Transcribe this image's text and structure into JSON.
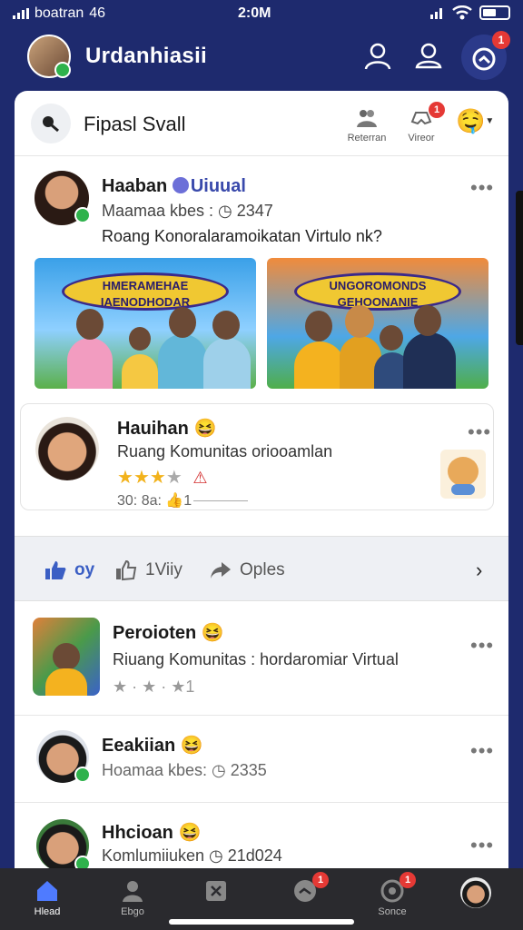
{
  "status_bar": {
    "carrier": "boatran",
    "network": "46",
    "time": "2:0M"
  },
  "header": {
    "title": "Urdanhiasii",
    "notification_count": "1"
  },
  "feed_header": {
    "title": "Fipasl Svall",
    "actions": [
      {
        "label": "Reterran",
        "badge": ""
      },
      {
        "label": "Vireor",
        "badge": "1"
      }
    ]
  },
  "post": {
    "author": "Haaban",
    "tag": "Uiuual",
    "meta": "Maamaa kbes : ◷ 2347",
    "text": "Roang Konoralaramoikatan Virtulo nk?",
    "photos": [
      {
        "banner": "HMERAMEHAE IAENODHODAR"
      },
      {
        "banner": "UNGOROMONDS GEHOONANIE"
      }
    ]
  },
  "review": {
    "author": "Hauihan",
    "emoji": "😆",
    "text": "Ruang Komunitas oriooamlan",
    "rating": 3,
    "max_rating": 4,
    "footer": "30: 8a: 👍1"
  },
  "actions": {
    "like": "oy",
    "comment": "1Viiy",
    "share": "Oples"
  },
  "list": [
    {
      "name": "Peroioten",
      "emoji": "😆",
      "sub": "Riuang Komunitas : hordaromiar Virtual",
      "footer": "★ · ★ · ★1"
    },
    {
      "name": "Eeakiian",
      "emoji": "😆",
      "sub": "Hoamaa kbes: ◷ 2335"
    },
    {
      "name": "Hhcioan",
      "emoji": "😆",
      "sub": "Komlumiiuken ◷ 21d024"
    }
  ],
  "bottom_nav": [
    {
      "label": "Hlead",
      "icon": "home-icon",
      "badge": ""
    },
    {
      "label": "Ebgo",
      "icon": "profile-icon",
      "badge": ""
    },
    {
      "label": "",
      "icon": "app-icon",
      "badge": ""
    },
    {
      "label": "",
      "icon": "chat-icon",
      "badge": "1"
    },
    {
      "label": "Sonce",
      "icon": "settings-icon",
      "badge": "1"
    },
    {
      "label": "",
      "icon": "avatar-icon",
      "badge": ""
    }
  ],
  "colors": {
    "brand": "#1e2a6e",
    "accent": "#3949ab",
    "badge": "#e53935",
    "online": "#2fb24c",
    "star": "#f2b21b"
  }
}
